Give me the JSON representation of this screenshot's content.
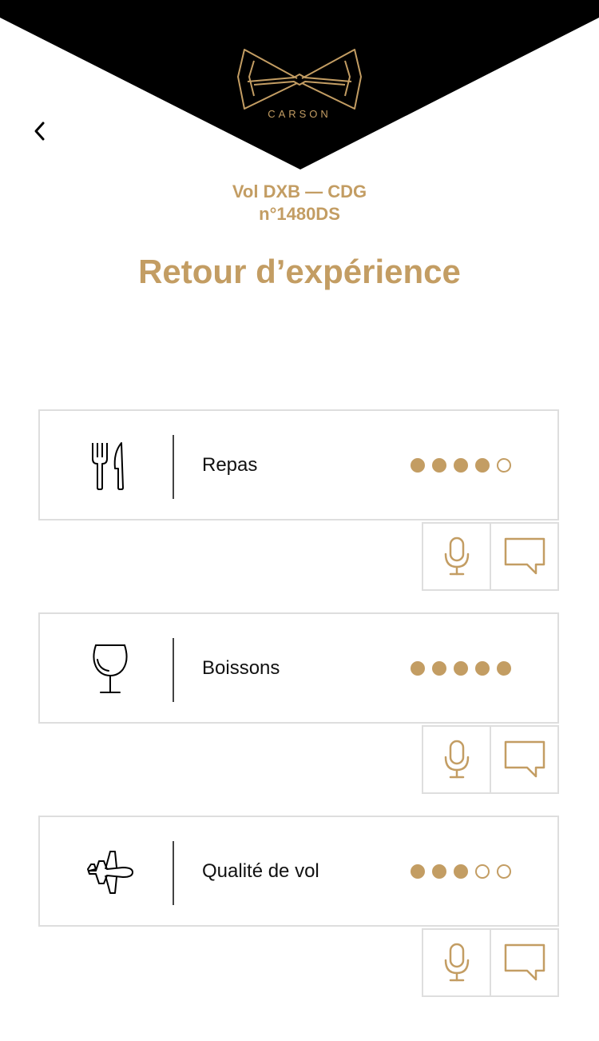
{
  "brand": {
    "name": "CARSON"
  },
  "flight": {
    "route": "Vol DXB — CDG",
    "number": "n°1480DS"
  },
  "page": {
    "title": "Retour d’expérience"
  },
  "colors": {
    "accent": "#c39d63",
    "header": "#000000",
    "border": "#dedede"
  },
  "categories": [
    {
      "label": "Repas",
      "icon": "cutlery-icon",
      "rating": 4,
      "max": 5
    },
    {
      "label": "Boissons",
      "icon": "wine-glass-icon",
      "rating": 5,
      "max": 5
    },
    {
      "label": "Qualité de vol",
      "icon": "airplane-icon",
      "rating": 3,
      "max": 5
    }
  ],
  "actions": {
    "voice_icon": "microphone-icon",
    "comment_icon": "speech-bubble-icon"
  }
}
